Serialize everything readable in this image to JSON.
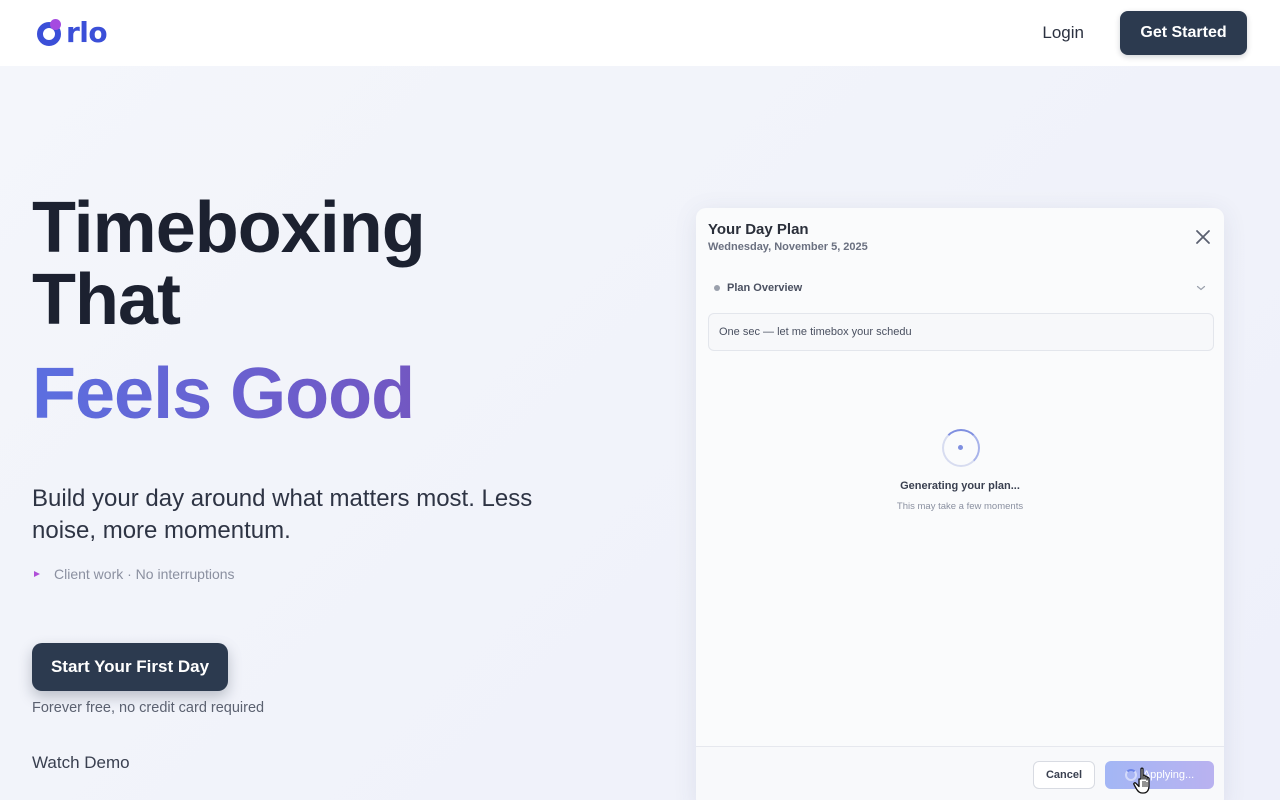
{
  "header": {
    "logo_text": "rlo",
    "login_label": "Login",
    "get_started_label": "Get Started"
  },
  "hero": {
    "title_line1": "Timeboxing",
    "title_line2": "That",
    "title_accent": "Feels Good",
    "subtitle": "Build your day around what matters most. Less noise, more momentum.",
    "bullet_text": "Client work · No interruptions",
    "cta_label": "Start Your First Day",
    "cta_note": "Forever free, no credit card required",
    "watch_demo_label": "Watch Demo"
  },
  "modal": {
    "title": "Your Day Plan",
    "date": "Wednesday, November 5, 2025",
    "overview_label": "Plan Overview",
    "message": "One sec — let me timebox your schedu",
    "generating_title": "Generating your plan...",
    "generating_sub": "This may take a few moments",
    "cancel_label": "Cancel",
    "apply_label": "Applying..."
  },
  "colors": {
    "brand_blue": "#3b4fd8",
    "brand_purple": "#a54be0",
    "dark_button": "#2c3a4f",
    "accent_gradient_start": "#5b6fe0",
    "accent_gradient_end": "#7257c2"
  },
  "icons": {
    "close": "close-icon",
    "chevron": "chevron-down-icon",
    "spinner": "spinner-icon",
    "cursor": "hand-pointer-icon"
  }
}
